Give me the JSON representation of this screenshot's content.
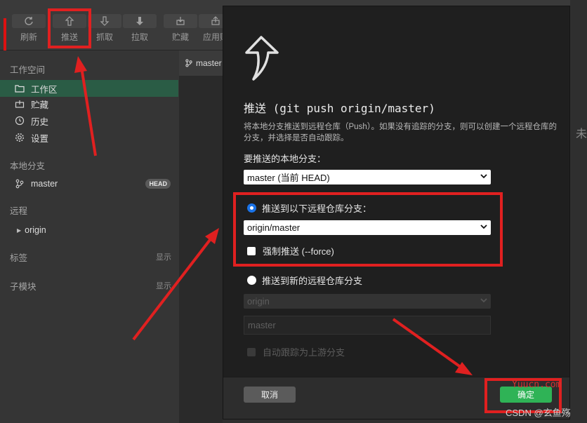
{
  "toolbar": {
    "items": [
      {
        "label": "刷新",
        "icon": "refresh-icon"
      },
      {
        "label": "推送",
        "icon": "push-icon"
      },
      {
        "label": "抓取",
        "icon": "fetch-icon"
      },
      {
        "label": "拉取",
        "icon": "pull-icon"
      },
      {
        "label": "贮藏",
        "icon": "stash-icon"
      },
      {
        "label": "应用贮",
        "icon": "apply-stash-icon"
      }
    ]
  },
  "sidebar": {
    "workspace_title": "工作空间",
    "workspace_items": [
      {
        "label": "工作区",
        "icon": "folder-icon",
        "active": true
      },
      {
        "label": "贮藏",
        "icon": "stash-box-icon"
      },
      {
        "label": "历史",
        "icon": "history-icon"
      },
      {
        "label": "设置",
        "icon": "gear-icon"
      }
    ],
    "local_branch_title": "本地分支",
    "branch_label": "master",
    "head_badge": "HEAD",
    "remote_title": "远程",
    "remote_label": "origin",
    "tags_title": "标签",
    "tags_show": "显示",
    "submodule_title": "子模块",
    "submodule_show": "显示"
  },
  "tab": {
    "label": "master"
  },
  "right_partial_text": "未",
  "dialog": {
    "title": "推送 (git push origin/master)",
    "desc": "将本地分支推送到远程仓库（Push）。如果没有追踪的分支，则可以创建一个远程仓库的分支，并选择是否自动跟踪。",
    "local_branch_label": "要推送的本地分支：",
    "local_branch_value": "master (当前 HEAD)",
    "radio_existing_label": "推送到以下远程仓库分支：",
    "remote_branch_value": "origin/master",
    "force_label": "强制推送 (--force)",
    "radio_new_label": "推送到新的远程仓库分支",
    "new_remote_value": "origin",
    "new_branch_value": "master",
    "auto_track_label": "自动跟踪为上游分支",
    "cancel_label": "取消",
    "ok_label": "确定"
  },
  "watermark": {
    "site": "Yuucn.com",
    "csdn": "CSDN @玄鱼殇"
  },
  "colors": {
    "accent_green": "#2fb356",
    "active_item": "#2a5c45",
    "annotation_red": "#e02020",
    "radio_blue": "#1a73e8"
  }
}
